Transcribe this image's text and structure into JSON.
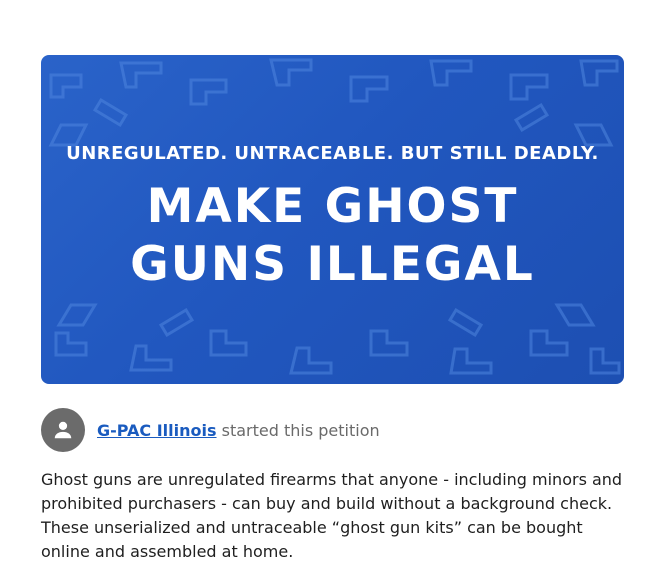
{
  "banner": {
    "line1": "UNREGULATED. UNTRACEABLE. BUT STILL DEADLY.",
    "line2": "MAKE GHOST",
    "line3": "GUNS ILLEGAL"
  },
  "starter": {
    "name": "G-PAC Illinois",
    "suffix": "started this petition"
  },
  "description": "Ghost guns are unregulated firearms that anyone - including minors and prohibited purchasers - can buy and build without a background check. These unserialized and untraceable “ghost gun kits” can be bought online and assembled at home."
}
